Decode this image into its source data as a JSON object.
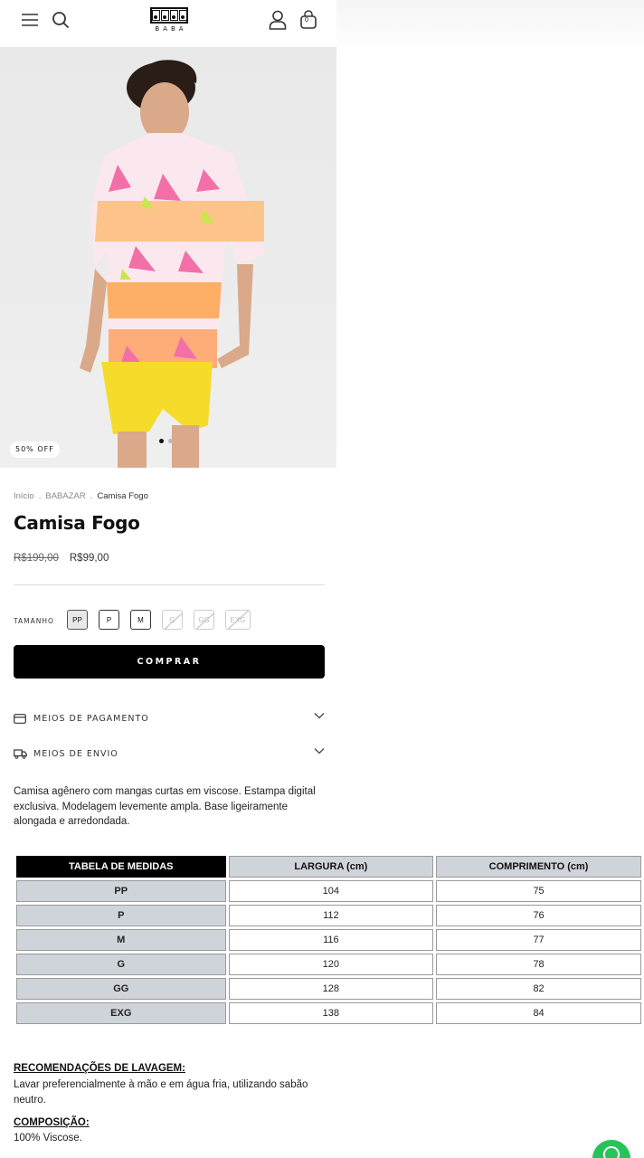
{
  "header": {
    "logo_text": "BABA",
    "cart_count": "0"
  },
  "product": {
    "badge": "50% OFF",
    "breadcrumb": [
      "Início",
      "BABAZAR",
      "Camisa Fogo"
    ],
    "title": "Camisa Fogo",
    "old_price": "R$199,00",
    "new_price": "R$99,00",
    "size_label": "TAMANHO",
    "sizes": [
      {
        "label": "PP",
        "state": "selected"
      },
      {
        "label": "P",
        "state": "available"
      },
      {
        "label": "M",
        "state": "available"
      },
      {
        "label": "G",
        "state": "unavailable"
      },
      {
        "label": "GG",
        "state": "unavailable"
      },
      {
        "label": "EXG",
        "state": "unavailable"
      }
    ],
    "buy_label": "COMPRAR",
    "payment_label": "MEIOS DE PAGAMENTO",
    "shipping_label": "MEIOS DE ENVIO",
    "description": "Camisa agênero com mangas curtas em viscose. Estampa digital exclusiva. Modelagem levemente ampla. Base ligeiramente alongada e arredondada."
  },
  "measure_table": {
    "headers": [
      "TABELA DE MEDIDAS",
      "LARGURA (cm)",
      "COMPRIMENTO (cm)"
    ],
    "rows": [
      [
        "PP",
        "104",
        "75"
      ],
      [
        "P",
        "112",
        "76"
      ],
      [
        "M",
        "116",
        "77"
      ],
      [
        "G",
        "120",
        "78"
      ],
      [
        "GG",
        "128",
        "82"
      ],
      [
        "EXG",
        "138",
        "84"
      ]
    ]
  },
  "care": {
    "wash_title": "RECOMENDAÇÕES DE LAVAGEM:",
    "wash_text": "Lavar preferencialmente à mão e em água fria, utilizando sabão neutro.",
    "composition_title": "COMPOSIÇÃO:",
    "composition_text": "100% Viscose."
  },
  "colors": {
    "accent_button": "#000000",
    "whatsapp": "#25c35a",
    "table_header": "#cfd4da"
  }
}
